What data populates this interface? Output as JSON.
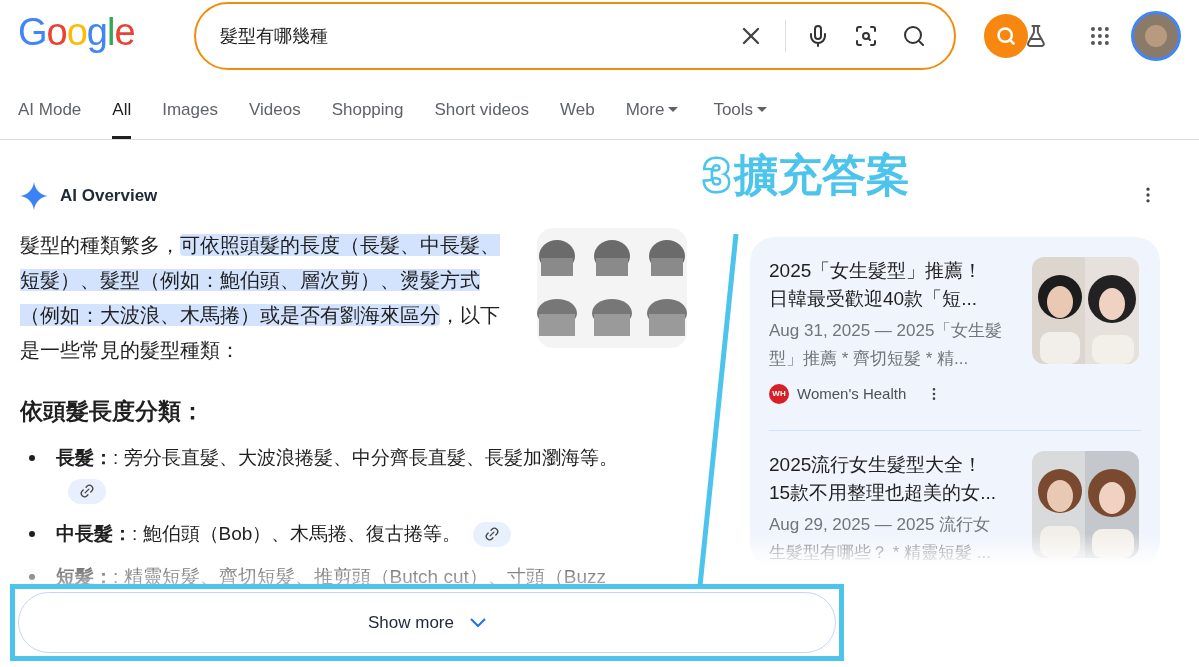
{
  "logo": "Google",
  "search": {
    "value": "髮型有哪幾種"
  },
  "tabs": [
    {
      "label": "AI Mode",
      "selected": false,
      "dropdown": false
    },
    {
      "label": "All",
      "selected": true,
      "dropdown": false
    },
    {
      "label": "Images",
      "selected": false,
      "dropdown": false
    },
    {
      "label": "Videos",
      "selected": false,
      "dropdown": false
    },
    {
      "label": "Shopping",
      "selected": false,
      "dropdown": false
    },
    {
      "label": "Short videos",
      "selected": false,
      "dropdown": false
    },
    {
      "label": "Web",
      "selected": false,
      "dropdown": false
    },
    {
      "label": "More",
      "selected": false,
      "dropdown": true
    },
    {
      "label": "Tools",
      "selected": false,
      "dropdown": true
    }
  ],
  "ai_overview": {
    "title": "AI Overview",
    "intro": [
      {
        "text": "髮型的種類繁多，",
        "highlighted": false
      },
      {
        "text": "可依照頭髮的長度（長髮、中長髮、短髮）、髮型（例如：鮑伯頭、層次剪）、燙髮方式（例如：大波浪、木馬捲）或是否有劉海來區分",
        "highlighted": true
      },
      {
        "text": "，以下是一些常見的髮型種類：",
        "highlighted": false
      }
    ],
    "heading": "依頭髮長度分類：",
    "items": [
      {
        "term": "長髮：",
        "text": ": 旁分長直髮、大波浪捲髮、中分齊長直髮、長髮加瀏海等。",
        "link": true
      },
      {
        "term": "中長髮：",
        "text": ": 鮑伯頭（Bob）、木馬捲、復古捲等。",
        "link": true
      },
      {
        "term": "短髮：",
        "text": ": 精靈短髮、齊切短髮、推剪頭（Butch cut）、寸頭（Buzz",
        "link": false
      }
    ],
    "show_more": "Show more"
  },
  "sources": [
    {
      "title": "2025「女生髮型」推薦！日韓最受歡迎40款「短...",
      "snippet": "Aug 31, 2025 — 2025「女生髮型」推薦 * 齊切短髮 * 精...",
      "site": "Women's Health",
      "site_logo": "WH"
    },
    {
      "title": "2025流行女生髮型大全！15款不用整理也超美的女...",
      "snippet": "Aug 29, 2025 — 2025 流行女生髮型有哪些？ * 精靈短髮 ..."
    }
  ],
  "annotation": {
    "number": "3",
    "label": "擴充答案"
  }
}
